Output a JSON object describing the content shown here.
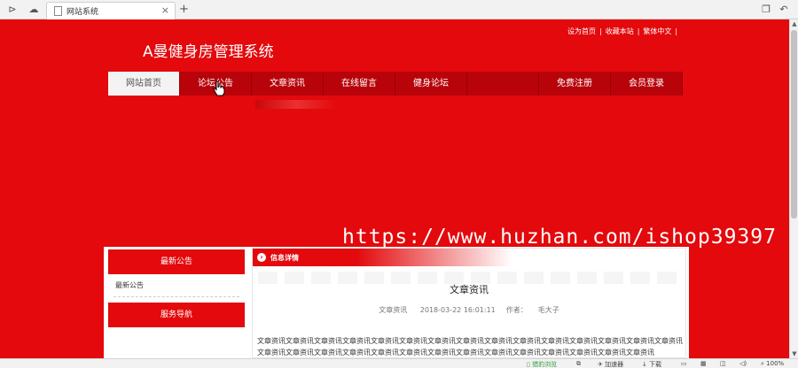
{
  "browser": {
    "tab_title": "网站系统",
    "new_tab": "+",
    "close": "×"
  },
  "site": {
    "title": "A曼健身房管理系统",
    "top_links": [
      "设为首页",
      "收藏本站",
      "繁体中文"
    ]
  },
  "nav": {
    "items": [
      "网站首页",
      "论坛公告",
      "文章资讯",
      "在线留言",
      "健身论坛",
      "",
      "免费注册",
      "会员登录"
    ],
    "active_index": 0
  },
  "watermark": "https://www.huzhan.com/ishop39397",
  "sidebar": {
    "notice_title": "最新公告",
    "notice_link": "最新公告",
    "service_title": "服务导航"
  },
  "main": {
    "header_title": "信息详情",
    "article_title": "文章资讯",
    "meta_category": "文章资讯",
    "meta_datetime": "2018-03-22 16:01:11",
    "meta_author_label": "作者：",
    "meta_author": "毛大子",
    "body": "文章资讯文章资讯文章资讯文章资讯文章资讯文章资讯文章资讯文章资讯文章资讯文章资讯文章资讯文章资讯文章资讯文章资讯文章资讯文章资讯文章资讯文章资讯文章资讯文章资讯文章资讯文章资讯文章资讯文章资讯文章资讯文章资讯文章资讯文章资讯文章资讯"
  },
  "statusbar": {
    "safe": "猎豹浏览",
    "accelerator": "加速器",
    "download": "下载",
    "zoom": "100%"
  },
  "colors": {
    "brand_red": "#e3090c",
    "nav_red": "#b8030a"
  }
}
